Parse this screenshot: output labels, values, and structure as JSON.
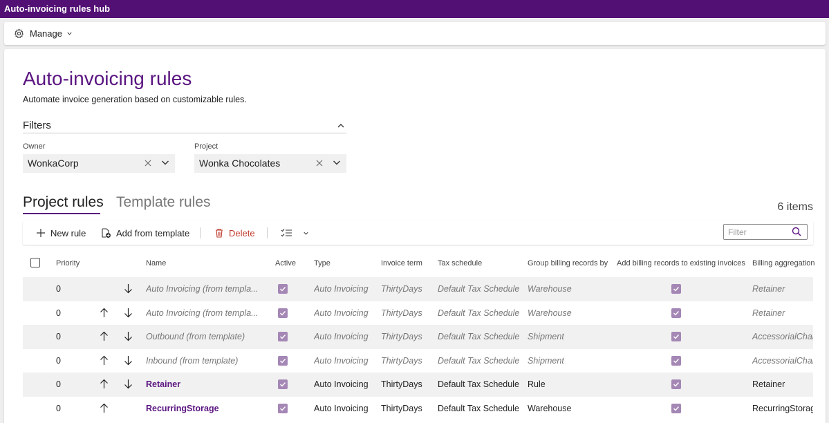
{
  "titlebar": {
    "title": "Auto-invoicing rules hub"
  },
  "commandbar": {
    "manage_label": "Manage",
    "manage_icon": "gear-icon"
  },
  "page": {
    "title": "Auto-invoicing rules",
    "subtitle": "Automate invoice generation based on customizable rules."
  },
  "filters": {
    "heading": "Filters",
    "owner": {
      "label": "Owner",
      "value": "WonkaCorp"
    },
    "project": {
      "label": "Project",
      "value": "Wonka Chocolates"
    }
  },
  "tabs": {
    "project_rules": "Project rules",
    "template_rules": "Template rules"
  },
  "items_count": "6 items",
  "toolbar": {
    "new_rule": "New rule",
    "add_from_template": "Add from template",
    "delete": "Delete",
    "filter_placeholder": "Filter"
  },
  "columns": {
    "priority": "Priority",
    "name": "Name",
    "active": "Active",
    "type": "Type",
    "invoice_term": "Invoice term",
    "tax_schedule": "Tax schedule",
    "group_by": "Group billing records by",
    "add_existing": "Add billing records to existing invoices",
    "aggregation": "Billing aggregation"
  },
  "rows": [
    {
      "priority": "0",
      "name": "Auto Invoicing (from templa...",
      "type": "Auto Invoicing",
      "term": "ThirtyDays",
      "tax": "Default Tax Schedule",
      "group": "Warehouse",
      "aggregation": "Retainer"
    },
    {
      "priority": "0",
      "name": "Auto Invoicing (from templa...",
      "type": "Auto Invoicing",
      "term": "ThirtyDays",
      "tax": "Default Tax Schedule",
      "group": "Warehouse",
      "aggregation": "Retainer"
    },
    {
      "priority": "0",
      "name": "Outbound (from template)",
      "type": "Auto Invoicing",
      "term": "ThirtyDays",
      "tax": "Default Tax Schedule",
      "group": "Shipment",
      "aggregation": "AccessorialCharg"
    },
    {
      "priority": "0",
      "name": "Inbound (from template)",
      "type": "Auto Invoicing",
      "term": "ThirtyDays",
      "tax": "Default Tax Schedule",
      "group": "Shipment",
      "aggregation": "AccessorialCharg"
    },
    {
      "priority": "0",
      "name": "Retainer",
      "type": "Auto Invoicing",
      "term": "ThirtyDays",
      "tax": "Default Tax Schedule",
      "group": "Rule",
      "aggregation": "Retainer"
    },
    {
      "priority": "0",
      "name": "RecurringStorage",
      "type": "Auto Invoicing",
      "term": "ThirtyDays",
      "tax": "Default Tax Schedule",
      "group": "Warehouse",
      "aggregation": "RecurringStorage"
    }
  ]
}
